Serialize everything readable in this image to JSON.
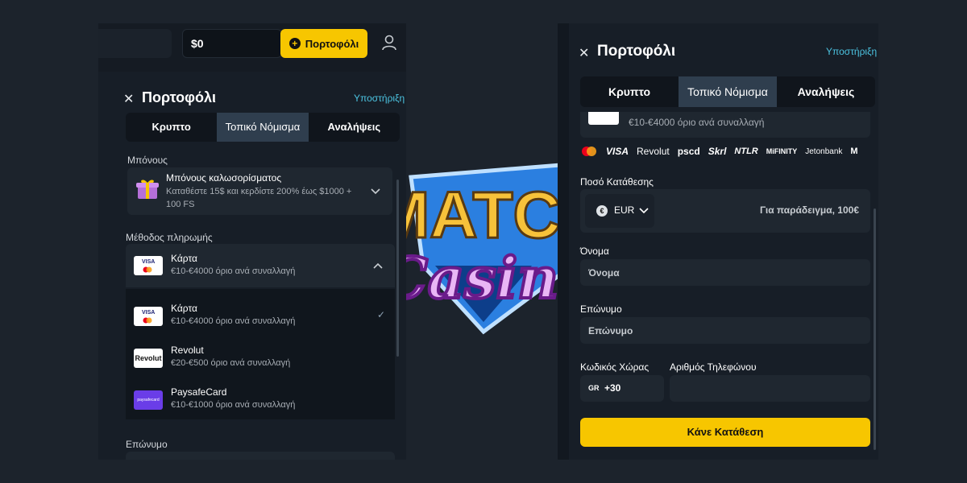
{
  "left": {
    "balance": "$0",
    "wallet_button": "Πορτοφόλι",
    "title": "Πορτοφόλι",
    "support": "Υποστήριξη",
    "tabs": [
      "Κρυπτο",
      "Τοπικό Νόμισμα",
      "Αναλήψεις"
    ],
    "bonus_label": "Μπόνους",
    "bonus": {
      "title": "Μπόνους καλωσορίσματος",
      "desc": "Καταθέστε 15$ και κερδίστε 200% έως $1000 + 100 FS"
    },
    "method_label": "Μέθοδος πληρωμής",
    "selected_method": {
      "name": "Κάρτα",
      "limit": "€10-€4000 όριο ανά συναλλαγή"
    },
    "methods": [
      {
        "name": "Κάρτα",
        "limit": "€10-€4000 όριο ανά συναλλαγή",
        "logo": "VISA"
      },
      {
        "name": "Revolut",
        "limit": "€20-€500 όριο ανά συναλλαγή",
        "logo": "Revolut"
      },
      {
        "name": "PaysafeCard",
        "limit": "€10-€1000 όριο ανά συναλλαγή",
        "logo": "paysafecard"
      }
    ],
    "last_name_label": "Επώνυμο"
  },
  "right": {
    "title": "Πορτοφόλι",
    "support": "Υποστήριξη",
    "tabs": [
      "Κρυπτο",
      "Τοπικό Νόμισμα",
      "Αναλήψεις"
    ],
    "partial_limit": "€10-€4000 όριο ανά συναλλαγή",
    "provider_logos": [
      "VISA",
      "Revolut",
      "pscd",
      "Skrl",
      "NTLR",
      "MiFINITY",
      "Jetonbank",
      "M"
    ],
    "amount_label": "Ποσό Κατάθεσης",
    "currency": "EUR",
    "currency_symbol": "€",
    "amount_placeholder": "Για παράδειγμα, 100€",
    "first_name_label": "Όνομα",
    "first_name_placeholder": "Όνομα",
    "last_name_label": "Επώνυμο",
    "last_name_placeholder": "Επώνυμο",
    "country_code_label": "Κωδικός Χώρας",
    "country_iso": "GR",
    "country_code": "+30",
    "phone_label": "Αριθμός Τηλεφώνου",
    "deposit_button": "Κάνε Κατάθεση"
  },
  "logo": {
    "top_text": "MATCH",
    "bottom_text": "Casino"
  },
  "colors": {
    "accent": "#f7c600",
    "support_link": "#4cc3e0",
    "background": "#1c232c",
    "tab_active": "#2f3e4e"
  }
}
